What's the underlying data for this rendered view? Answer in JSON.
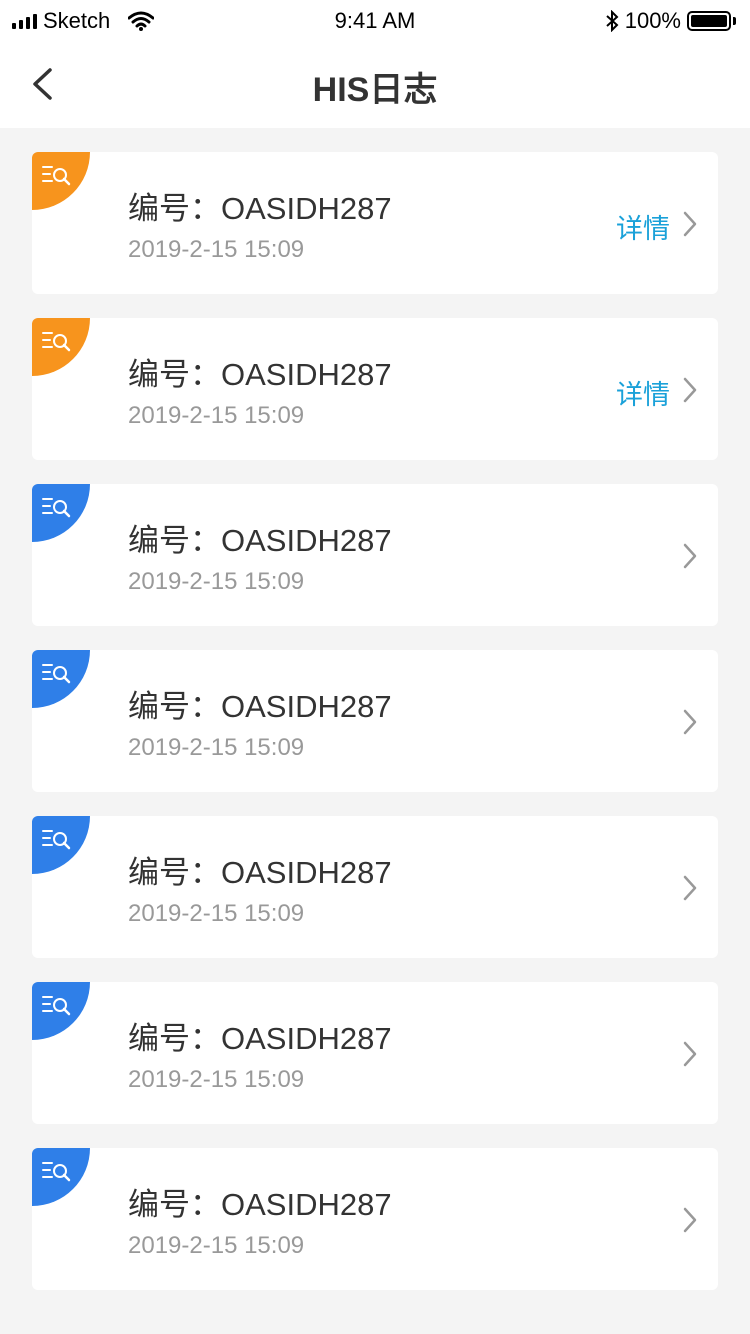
{
  "status_bar": {
    "carrier": "Sketch",
    "time": "9:41 AM",
    "battery": "100%",
    "icons": [
      "signal-icon",
      "wifi-icon",
      "bluetooth-icon",
      "battery-icon"
    ]
  },
  "nav": {
    "title": "HIS日志",
    "back_icon": "chevron-left-icon"
  },
  "colors": {
    "orange": "#f7941d",
    "blue": "#2f7fe8",
    "link": "#1aa1d9",
    "chevron": "#999999"
  },
  "log_items": [
    {
      "id_label": "编号：OASIDH287",
      "time": "2019-2-15 15:09",
      "badge": "orange",
      "detail": "详情"
    },
    {
      "id_label": "编号：OASIDH287",
      "time": "2019-2-15 15:09",
      "badge": "orange",
      "detail": "详情"
    },
    {
      "id_label": "编号：OASIDH287",
      "time": "2019-2-15 15:09",
      "badge": "blue",
      "detail": ""
    },
    {
      "id_label": "编号：OASIDH287",
      "time": "2019-2-15 15:09",
      "badge": "blue",
      "detail": ""
    },
    {
      "id_label": "编号：OASIDH287",
      "time": "2019-2-15 15:09",
      "badge": "blue",
      "detail": ""
    },
    {
      "id_label": "编号：OASIDH287",
      "time": "2019-2-15 15:09",
      "badge": "blue",
      "detail": ""
    },
    {
      "id_label": "编号：OASIDH287",
      "time": "2019-2-15 15:09",
      "badge": "blue",
      "detail": ""
    }
  ]
}
